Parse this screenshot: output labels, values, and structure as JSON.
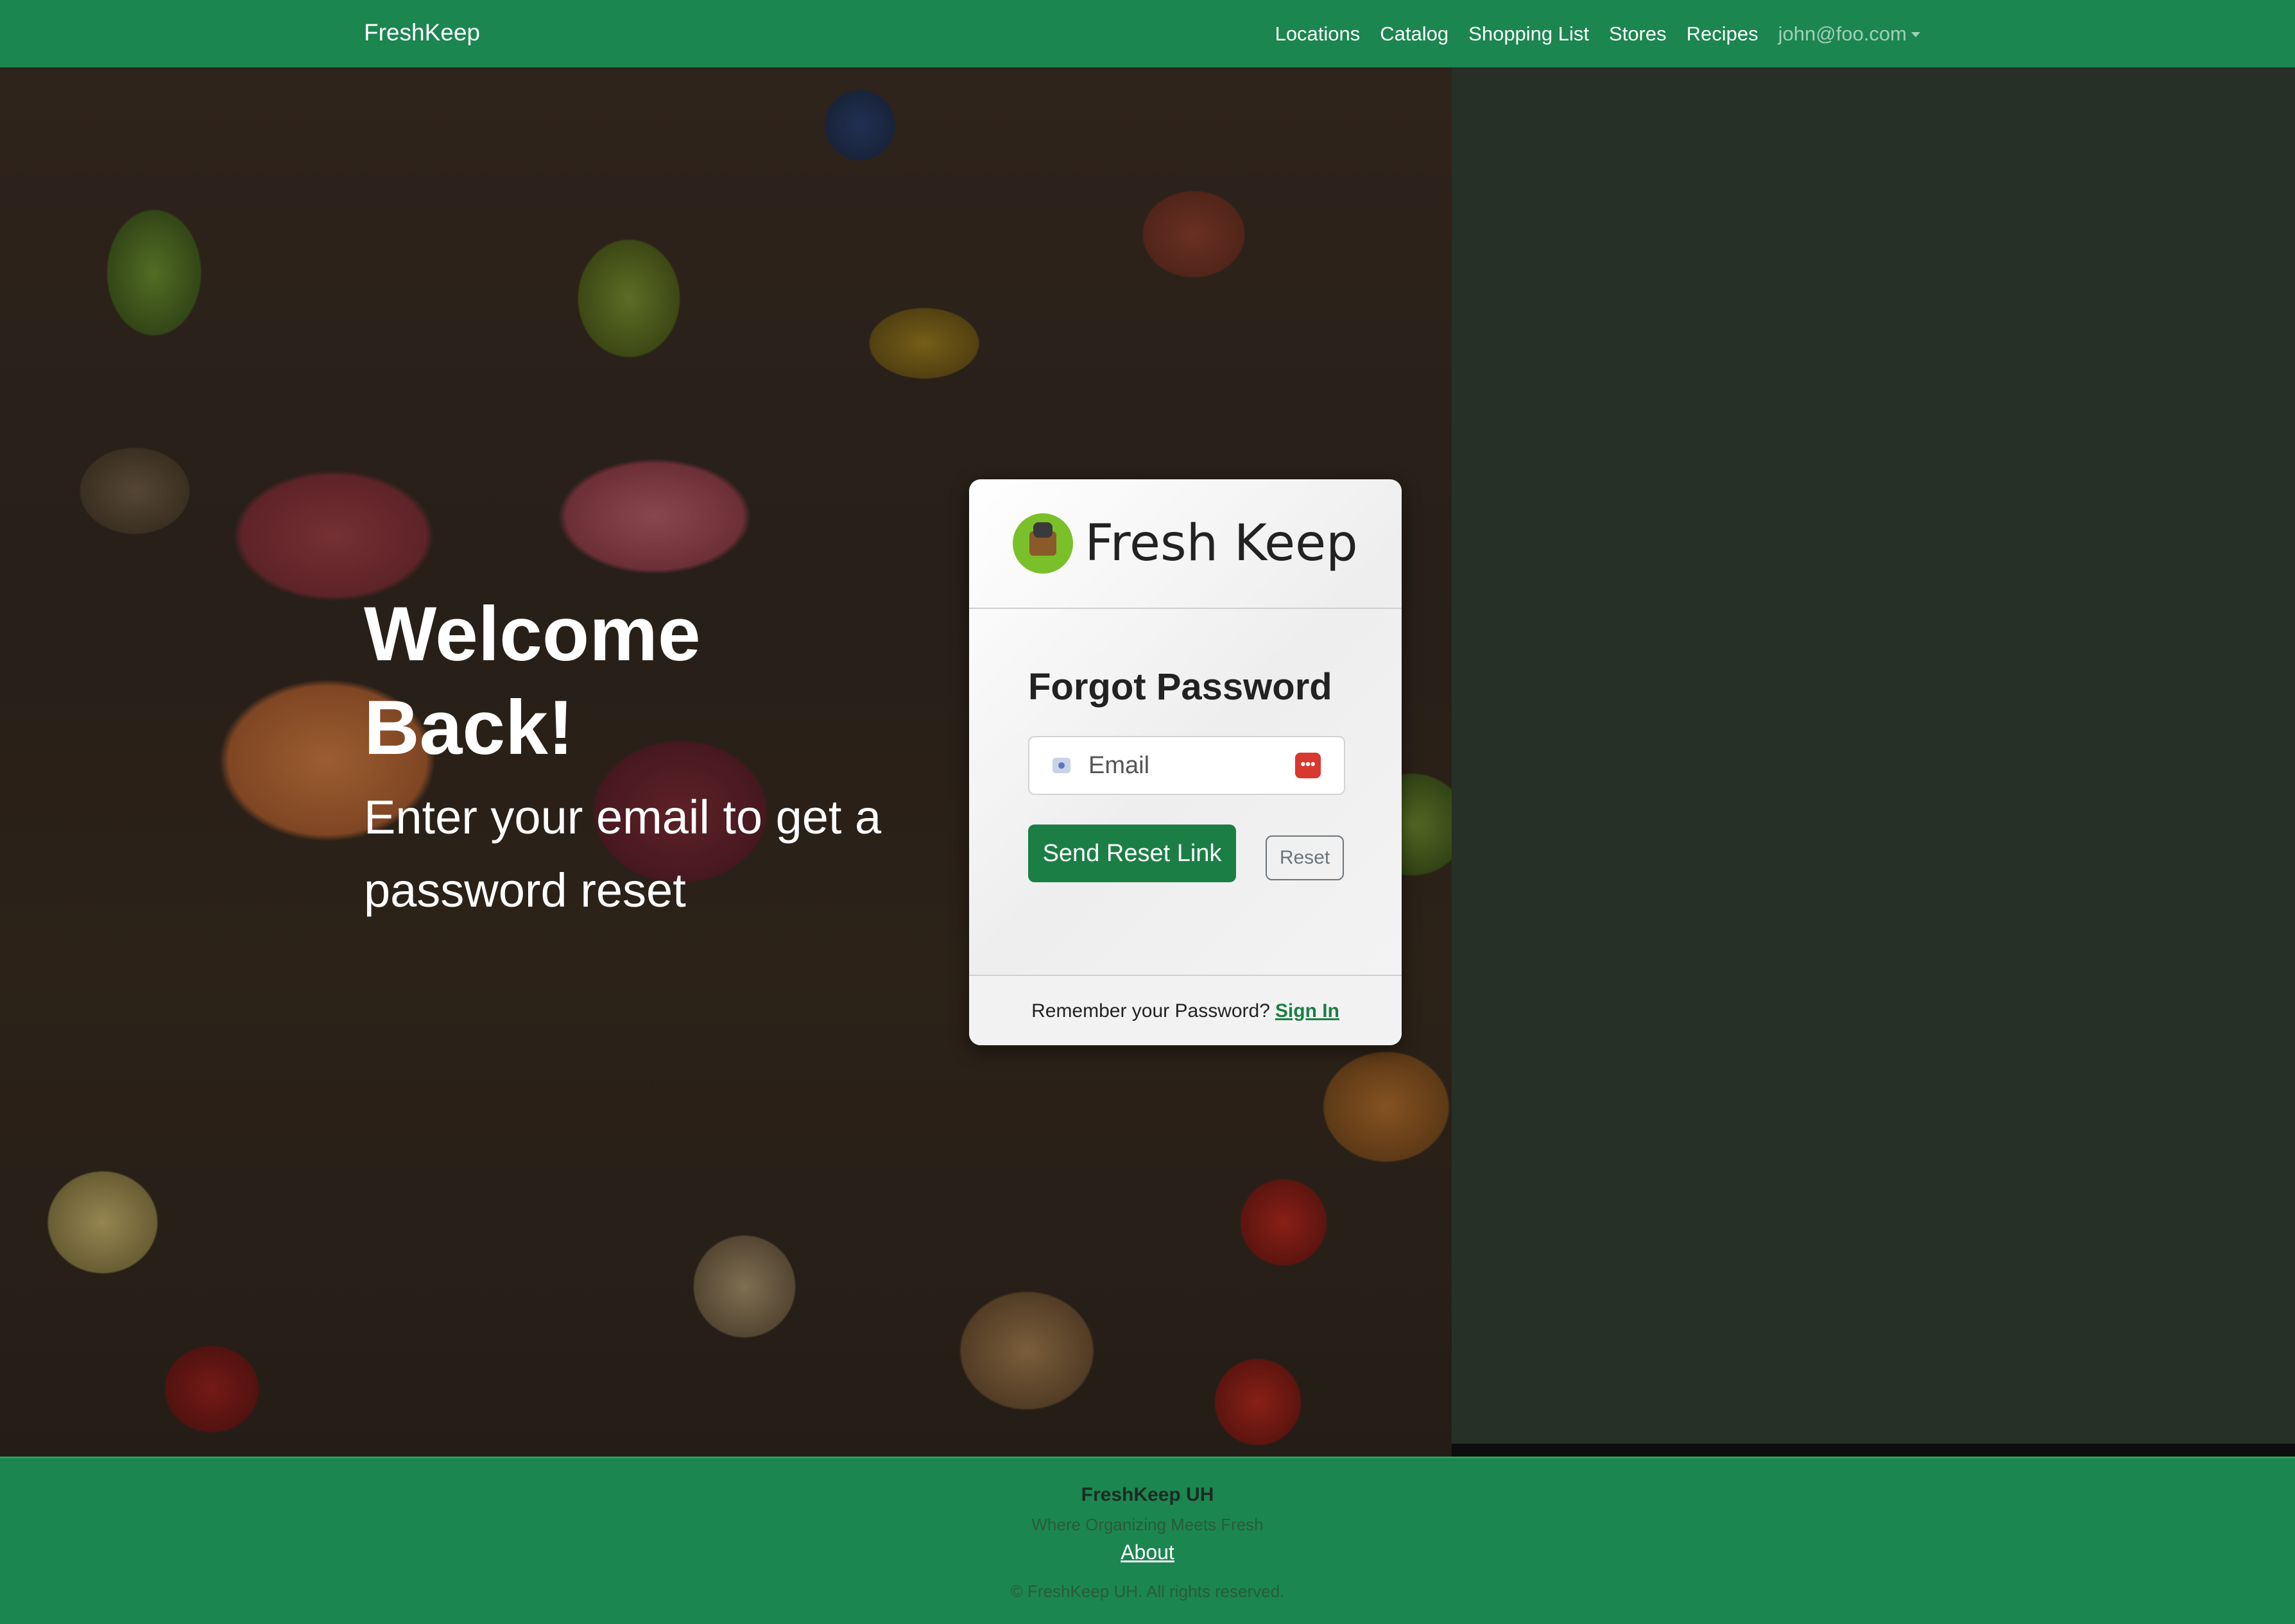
{
  "navbar": {
    "brand": "FreshKeep",
    "links": [
      "Locations",
      "Catalog",
      "Shopping List",
      "Stores",
      "Recipes"
    ],
    "user": "john@foo.com"
  },
  "hero": {
    "title": "Welcome Back!",
    "subtitle": "Enter your email to get a password reset"
  },
  "card": {
    "brand_title": "Fresh Keep",
    "heading": "Forgot Password",
    "email_placeholder": "Email",
    "send_button": "Send Reset Link",
    "reset_button": "Reset",
    "footer_text": "Remember your Password?",
    "signin_link": "Sign In"
  },
  "footer": {
    "name": "FreshKeep UH",
    "tagline": "Where Organizing Meets Fresh",
    "about": "About",
    "copyright": "© FreshKeep UH. All rights reserved."
  },
  "colors": {
    "brand_green": "#1b8650",
    "button_green": "#1b7f45",
    "right_panel": "#263027"
  }
}
